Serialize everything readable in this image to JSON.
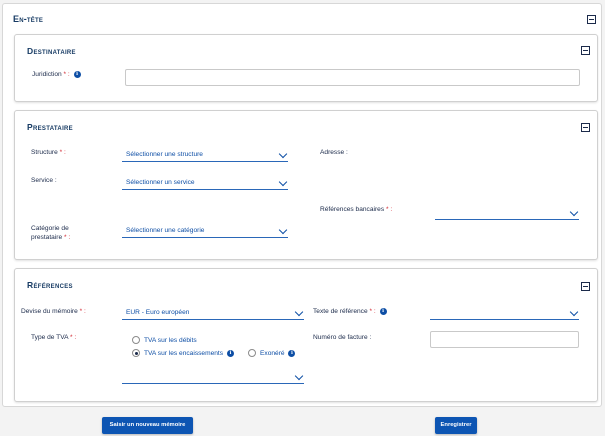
{
  "header": {
    "title": "En-tête"
  },
  "destinataire": {
    "title": "Destinataire",
    "juridiction_label": "Juridiction",
    "required_mark": "* :",
    "info_glyph": "i",
    "juridiction_value": ""
  },
  "prestataire": {
    "title": "Prestataire",
    "structure_label": "Structure",
    "structure_req": "* :",
    "structure_value": "Sélectionner une structure",
    "adresse_label": "Adresse :",
    "service_label": "Service :",
    "service_value": "Sélectionner un service",
    "references_bancaires_label": "Références bancaires",
    "references_bancaires_req": "* :",
    "categorie_label_1": "Catégorie de",
    "categorie_label_2": "prestataire",
    "categorie_req": "* :",
    "categorie_value": "Sélectionner une catégorie"
  },
  "references": {
    "title": "Références",
    "devise_label": "Devise du mémoire",
    "devise_req": "* :",
    "devise_value": "EUR - Euro européen",
    "texte_ref_label": "Texte de référence",
    "texte_ref_req": "* :",
    "type_tva_label": "Type de TVA",
    "type_tva_req": "* :",
    "tva_options": [
      "TVA sur les débits",
      "TVA sur les encaissements",
      "Exonéré"
    ],
    "tva_selected": "TVA sur les encaissements",
    "numero_facture_label": "Numéro de facture :"
  },
  "footer": {
    "new_memo_button": "Saisir un nouveau mémoire",
    "save_button": "Enregistrer"
  },
  "colors": {
    "primary": "#0d55b3",
    "title": "#163a63",
    "required": "#d0202a"
  },
  "icons": [
    "collapse-toggle-icon",
    "info-icon",
    "chevron-down-icon",
    "radio-icon"
  ]
}
